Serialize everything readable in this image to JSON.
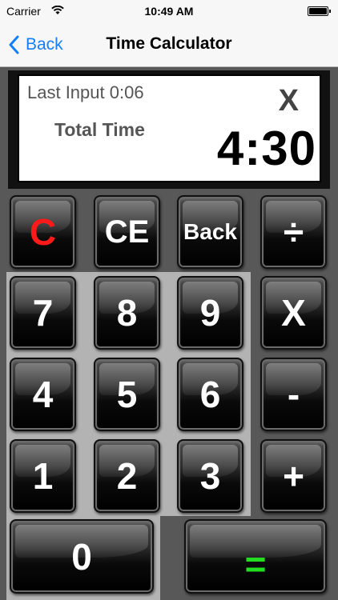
{
  "status_bar": {
    "carrier": "Carrier",
    "time": "10:49 AM"
  },
  "nav": {
    "back_label": "Back",
    "title": "Time Calculator"
  },
  "display": {
    "last_input": "Last Input 0:06",
    "total_label": "Total Time",
    "operator": "X",
    "result": "4:30"
  },
  "keys": {
    "clear": "C",
    "clear_entry": "CE",
    "backspace": "Back",
    "divide": "÷",
    "seven": "7",
    "eight": "8",
    "nine": "9",
    "multiply": "X",
    "four": "4",
    "five": "5",
    "six": "6",
    "minus": "-",
    "one": "1",
    "two": "2",
    "three": "3",
    "plus": "+",
    "zero": "0",
    "equals": "="
  },
  "colors": {
    "accent_blue": "#147efb",
    "clear_red": "#ff1a1a",
    "equals_green": "#22dd22",
    "key_text": "#ffffff"
  }
}
